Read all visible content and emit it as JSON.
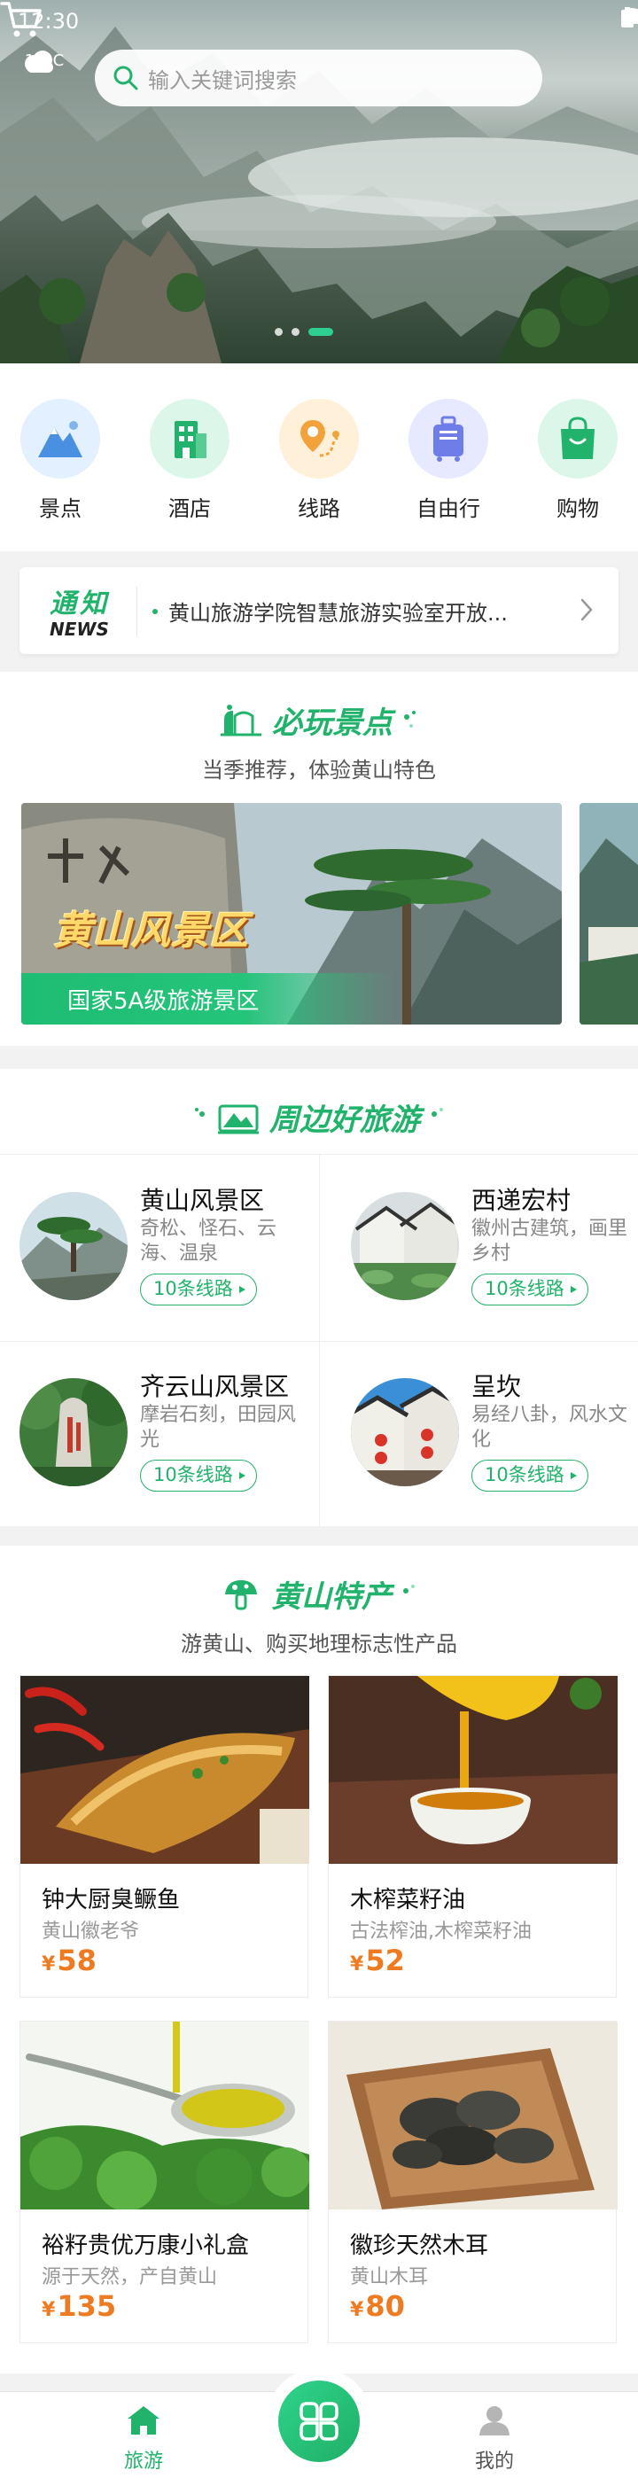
{
  "status_bar": {
    "time": "12:30"
  },
  "weather": {
    "temperature": "18°C"
  },
  "search": {
    "placeholder": "输入关键词搜索"
  },
  "hero": {
    "slide_count": 3,
    "active_slide": 3
  },
  "categories": [
    {
      "label": "景点",
      "icon": "mountain-icon",
      "color": "#4a90e2",
      "bg": "#e3f0ff"
    },
    {
      "label": "酒店",
      "icon": "building-icon",
      "color": "#21b36b",
      "bg": "#dcf7ea"
    },
    {
      "label": "线路",
      "icon": "route-pin-icon",
      "color": "#f2a23a",
      "bg": "#fff0d9"
    },
    {
      "label": "自由行",
      "icon": "luggage-icon",
      "color": "#6f7de8",
      "bg": "#e6e9ff"
    },
    {
      "label": "购物",
      "icon": "shopping-bag-icon",
      "color": "#21b36b",
      "bg": "#dcf7ea"
    }
  ],
  "notice": {
    "title": "通知",
    "subtitle": "NEWS",
    "text": "黄山旅游学院智慧旅游实验室开放..."
  },
  "must_visit": {
    "title": "必玩景点",
    "subtitle": "当季推荐，体验黄山特色",
    "banner_title": "黄山风景区",
    "banner_tag": "国家5A级旅游景区"
  },
  "nearby": {
    "title": "周边好旅游",
    "items": [
      {
        "name": "黄山风景区",
        "desc": "奇松、怪石、云海、温泉",
        "routes": "10条线路"
      },
      {
        "name": "西递宏村",
        "desc": "徽州古建筑，画里乡村",
        "routes": "10条线路"
      },
      {
        "name": "齐云山风景区",
        "desc": "摩岩石刻，田园风光",
        "routes": "10条线路"
      },
      {
        "name": "呈坎",
        "desc": "易经八卦，风水文化",
        "routes": "10条线路"
      }
    ]
  },
  "specialties": {
    "title": "黄山特产",
    "subtitle": "游黄山、购买地理标志性产品",
    "currency": "¥",
    "items": [
      {
        "name": "钟大厨臭鳜鱼",
        "sub": "黄山徽老爷",
        "price": "58"
      },
      {
        "name": "木榨菜籽油",
        "sub": "古法榨油,木榨菜籽油",
        "price": "52"
      },
      {
        "name": "裕籽贵优万康小礼盒",
        "sub": "源于天然，产自黄山",
        "price": "135"
      },
      {
        "name": "徽珍天然木耳",
        "sub": "黄山木耳",
        "price": "80"
      }
    ]
  },
  "tabbar": {
    "tabs": [
      {
        "label": "旅游",
        "icon": "home-icon",
        "active": true
      },
      {
        "label": "我的",
        "icon": "user-icon",
        "active": false
      }
    ],
    "accent": "#21b36b"
  }
}
